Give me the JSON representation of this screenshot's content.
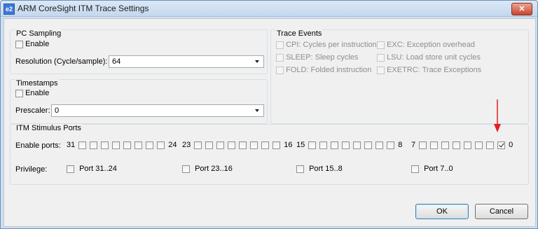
{
  "window": {
    "icon": "e2",
    "title": "ARM CoreSight ITM Trace Settings",
    "close_label": "✕"
  },
  "pc_sampling": {
    "title": "PC Sampling",
    "enable_label": "Enable",
    "enable_checked": false,
    "resolution_label": "Resolution (Cycle/sample):",
    "resolution_value": "64"
  },
  "timestamps": {
    "title": "Timestamps",
    "enable_label": "Enable",
    "enable_checked": false,
    "prescaler_label": "Prescaler:",
    "prescaler_value": "0"
  },
  "trace_events": {
    "title": "Trace Events",
    "items": [
      {
        "label": "CPI: Cycles per instruction",
        "checked": false,
        "enabled": false
      },
      {
        "label": "EXC: Exception overhead",
        "checked": false,
        "enabled": false
      },
      {
        "label": "SLEEP: Sleep cycles",
        "checked": false,
        "enabled": false
      },
      {
        "label": "LSU: Load store unit cycles",
        "checked": false,
        "enabled": false
      },
      {
        "label": "FOLD: Folded instruction",
        "checked": false,
        "enabled": false
      },
      {
        "label": "EXETRC: Trace Exceptions",
        "checked": false,
        "enabled": false
      }
    ]
  },
  "itm_stimulus": {
    "title": "ITM Stimulus Ports",
    "enable_ports_label": "Enable ports:",
    "port_groups": [
      {
        "high": "31",
        "low": "24",
        "checked": [
          false,
          false,
          false,
          false,
          false,
          false,
          false,
          false
        ]
      },
      {
        "high": "23",
        "low": "16",
        "checked": [
          false,
          false,
          false,
          false,
          false,
          false,
          false,
          false
        ]
      },
      {
        "high": "15",
        "low": "8",
        "checked": [
          false,
          false,
          false,
          false,
          false,
          false,
          false,
          false
        ]
      },
      {
        "high": "7",
        "low": "0",
        "checked": [
          false,
          false,
          false,
          false,
          false,
          false,
          false,
          true
        ]
      }
    ],
    "privilege_label": "Privilege:",
    "privilege_items": [
      {
        "label": "Port 31..24",
        "checked": false
      },
      {
        "label": "Port 23..16",
        "checked": false
      },
      {
        "label": "Port 15..8",
        "checked": false
      },
      {
        "label": "Port 7..0",
        "checked": false
      }
    ]
  },
  "buttons": {
    "ok": "OK",
    "cancel": "Cancel"
  },
  "annotation": {
    "arrow_color": "#e02020"
  }
}
